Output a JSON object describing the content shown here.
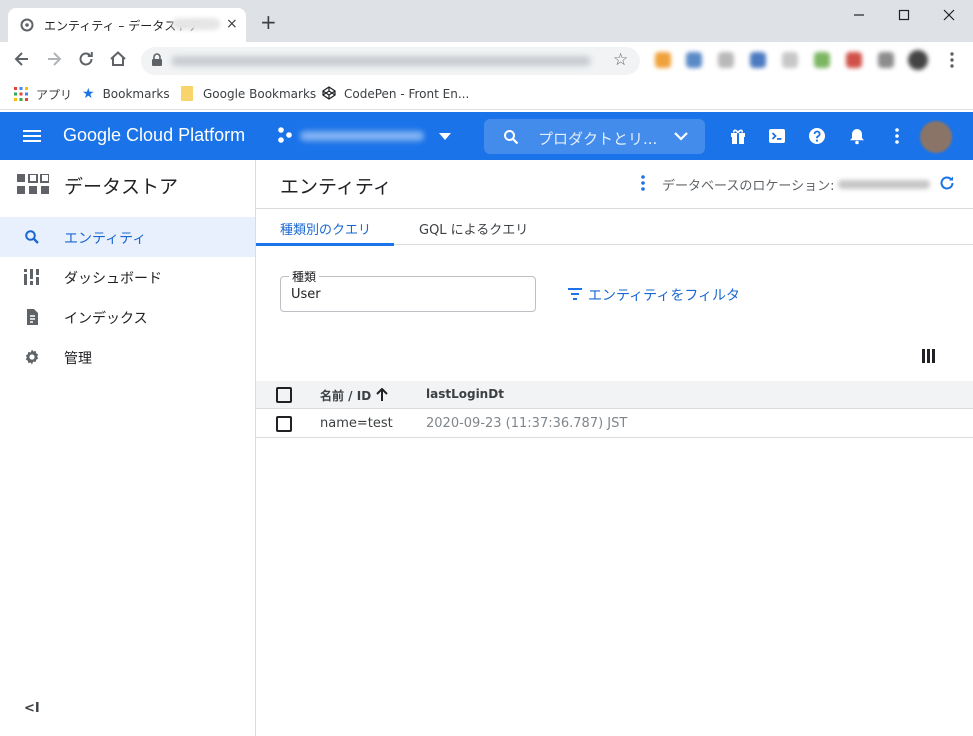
{
  "browser": {
    "tab_title": "エンティティ – データストア",
    "tab_close": "×",
    "new_tab": "+",
    "window_controls": [
      "—",
      "☐",
      "✕"
    ],
    "bookmarks": [
      {
        "label": "アプリ",
        "icon": "apps-grid-icon"
      },
      {
        "label": "Bookmarks",
        "icon": "star-icon"
      },
      {
        "label": "Google Bookmarks",
        "icon": "folder-icon"
      },
      {
        "label": "CodePen - Front En...",
        "icon": "codepen-icon"
      }
    ]
  },
  "header": {
    "brand": "Google Cloud Platform",
    "search_placeholder": "プロダクトとリ...",
    "accent_color": "#1a73e8"
  },
  "sidebar": {
    "product_title": "データストア",
    "items": [
      {
        "label": "エンティティ",
        "icon": "search-icon",
        "active": true
      },
      {
        "label": "ダッシュボード",
        "icon": "dashboard-icon",
        "active": false
      },
      {
        "label": "インデックス",
        "icon": "index-icon",
        "active": false
      },
      {
        "label": "管理",
        "icon": "gear-icon",
        "active": false
      }
    ],
    "collapse_label": "<I"
  },
  "main": {
    "page_title": "エンティティ",
    "location_label": "データベースのロケーション:",
    "tabs": [
      {
        "label": "種類別のクエリ",
        "active": true
      },
      {
        "label": "GQL によるクエリ",
        "active": false
      }
    ],
    "kind_field": {
      "label": "種類",
      "value": "User"
    },
    "filter_label": "エンティティをフィルタ",
    "table": {
      "columns": [
        "名前 / ID",
        "lastLoginDt"
      ],
      "sort_indicator": "↑",
      "rows": [
        {
          "name": "name=test",
          "lastLoginDt": "2020-09-23 (11:37:36.787) JST"
        }
      ]
    }
  }
}
